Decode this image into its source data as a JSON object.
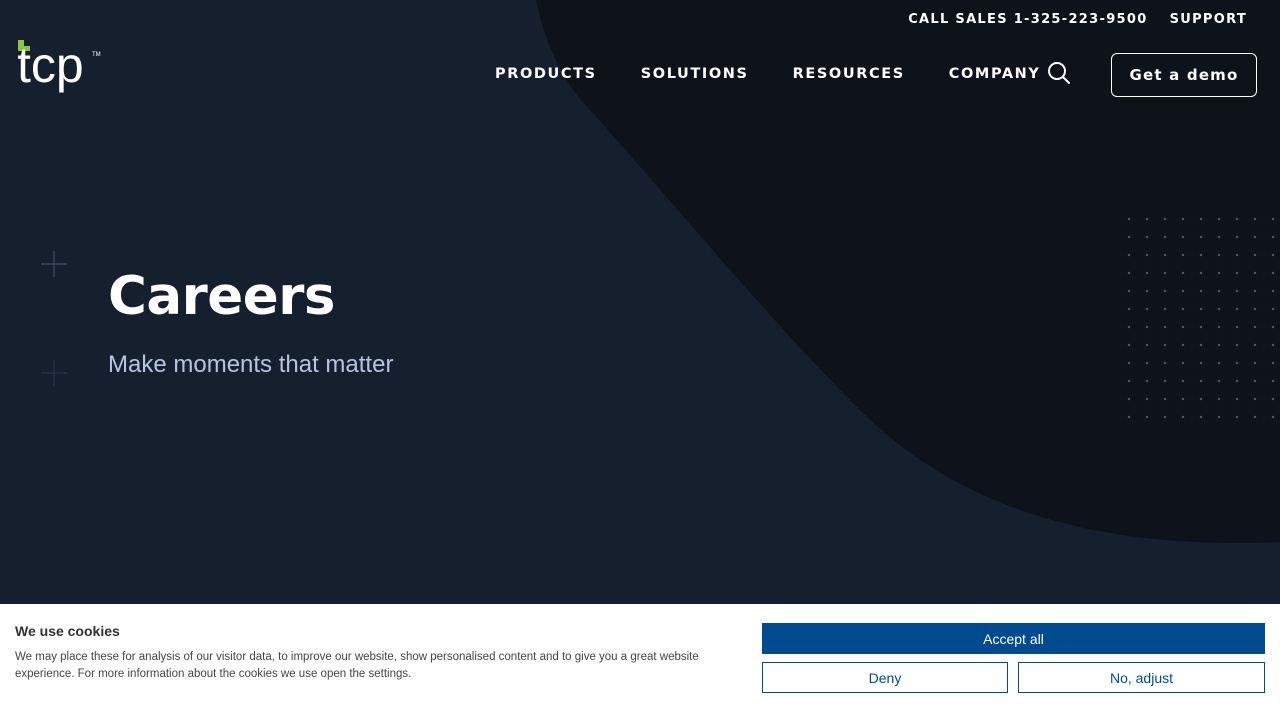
{
  "header": {
    "utility_links": [
      {
        "label": "CALL SALES 1-325-223-9500"
      },
      {
        "label": "SUPPORT"
      }
    ],
    "logo": {
      "text": "tcp",
      "trademark": "TM",
      "accent_color": "#8cc63f"
    },
    "nav_items": [
      {
        "label": "PRODUCTS"
      },
      {
        "label": "SOLUTIONS"
      },
      {
        "label": "RESOURCES"
      },
      {
        "label": "COMPANY"
      }
    ],
    "search_icon": "search-icon",
    "cta_label": "Get a demo"
  },
  "hero": {
    "title": "Careers",
    "subtitle": "Make moments that matter"
  },
  "cookie_banner": {
    "title": "We use cookies",
    "text": "We may place these for analysis of our visitor data, to improve our website, show personalised content and to give you a great website experience. For more information about the cookies we use open the settings.",
    "accept_label": "Accept all",
    "deny_label": "Deny",
    "adjust_label": "No, adjust"
  },
  "colors": {
    "background": "#161f2e",
    "dark_shape": "#0e121b",
    "button_blue": "#004a8f",
    "subtitle": "#b7c4e0"
  }
}
